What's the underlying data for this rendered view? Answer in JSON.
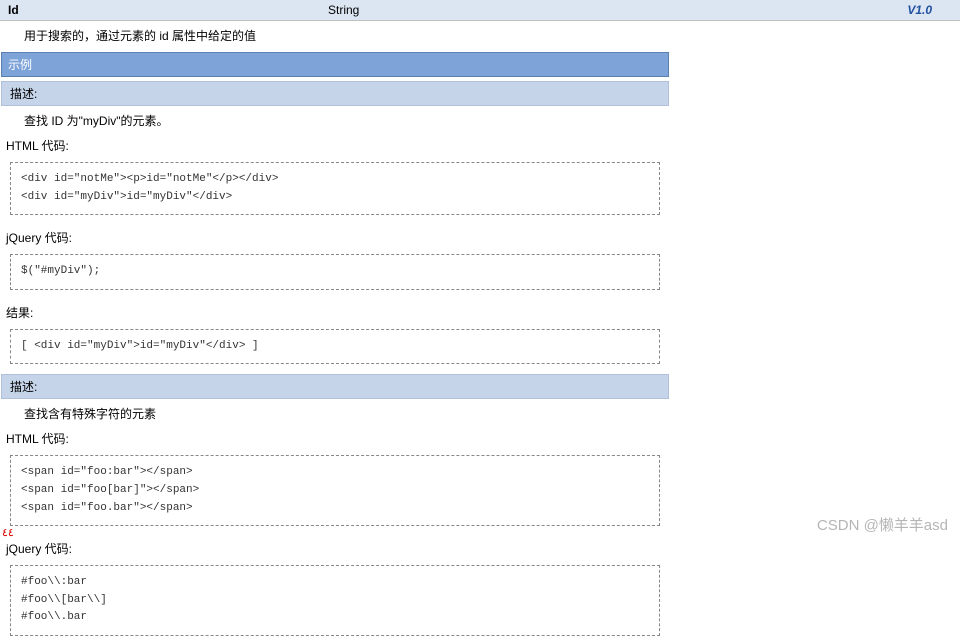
{
  "header": {
    "id": "Id",
    "type": "String",
    "version": "V1.0"
  },
  "top_desc": "用于搜索的，通过元素的 id 属性中给定的值",
  "example_label": "示例",
  "sections": [
    {
      "desc_label": "描述:",
      "desc_text": "查找 ID 为\"myDiv\"的元素。",
      "blocks": [
        {
          "label": "HTML 代码:",
          "code": "<div id=\"notMe\"><p>id=\"notMe\"</p></div>\n<div id=\"myDiv\">id=\"myDiv\"</div>"
        },
        {
          "label": "jQuery 代码:",
          "code": "$(\"#myDiv\");"
        },
        {
          "label": "结果:",
          "code": "[ <div id=\"myDiv\">id=\"myDiv\"</div> ]"
        }
      ]
    },
    {
      "desc_label": "描述:",
      "desc_text": "查找含有特殊字符的元素",
      "blocks": [
        {
          "label": "HTML 代码:",
          "code": "<span id=\"foo:bar\"></span>\n<span id=\"foo[bar]\"></span>\n<span id=\"foo.bar\"></span>"
        },
        {
          "label": "jQuery 代码:",
          "code": "#foo\\\\:bar\n#foo\\\\[bar\\\\]\n#foo\\\\.bar"
        }
      ]
    }
  ],
  "watermark": "CSDN @懒羊羊asd",
  "red_mark": "٤٤"
}
